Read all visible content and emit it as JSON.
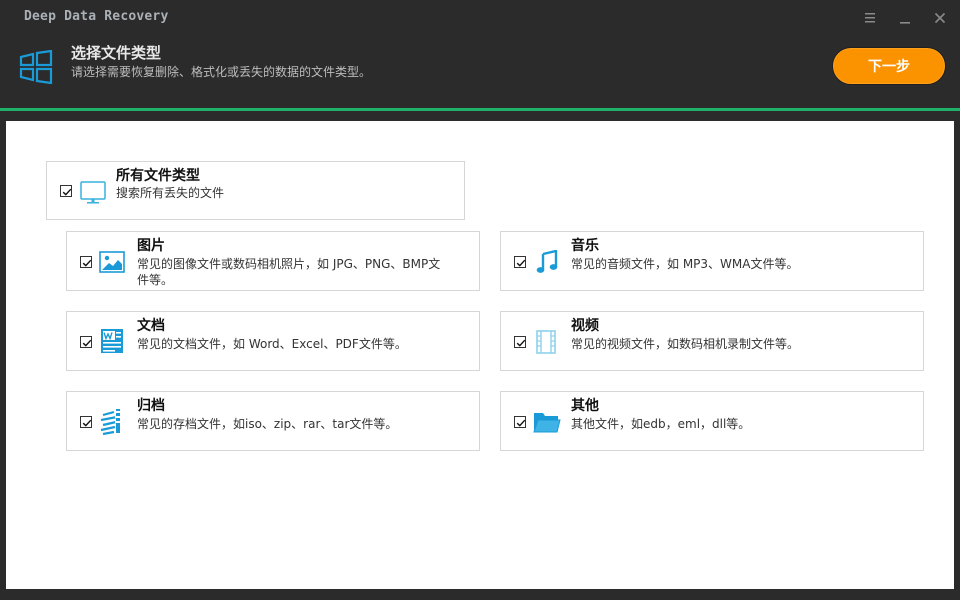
{
  "app": {
    "title": "Deep Data Recovery"
  },
  "header": {
    "title": "选择文件类型",
    "subtitle": "请选择需要恢复删除、格式化或丢失的数据的文件类型。",
    "next_label": "下一步"
  },
  "all_types": {
    "title": "所有文件类型",
    "desc": "搜索所有丢失的文件",
    "checked": true
  },
  "categories": [
    {
      "title": "图片",
      "desc": "常见的图像文件或数码相机照片，如 JPG、PNG、BMP文件等。",
      "checked": true,
      "icon": "image-icon"
    },
    {
      "title": "音乐",
      "desc": "常见的音频文件，如 MP3、WMA文件等。",
      "checked": true,
      "icon": "music-icon"
    },
    {
      "title": "文档",
      "desc": "常见的文档文件，如 Word、Excel、PDF文件等。",
      "checked": true,
      "icon": "word-document-icon"
    },
    {
      "title": "视频",
      "desc": "常见的视频文件，如数码相机录制文件等。",
      "checked": true,
      "icon": "film-icon"
    },
    {
      "title": "归档",
      "desc": "常见的存档文件，如iso、zip、rar、tar文件等。",
      "checked": true,
      "icon": "archive-icon"
    },
    {
      "title": "其他",
      "desc": "其他文件，如edb，eml，dll等。",
      "checked": true,
      "icon": "folder-icon"
    }
  ],
  "colors": {
    "accent": "#fb9200",
    "divider": "#1fb169",
    "icon_blue": "#1a9bd7",
    "header_bg": "#2b2b2b"
  }
}
